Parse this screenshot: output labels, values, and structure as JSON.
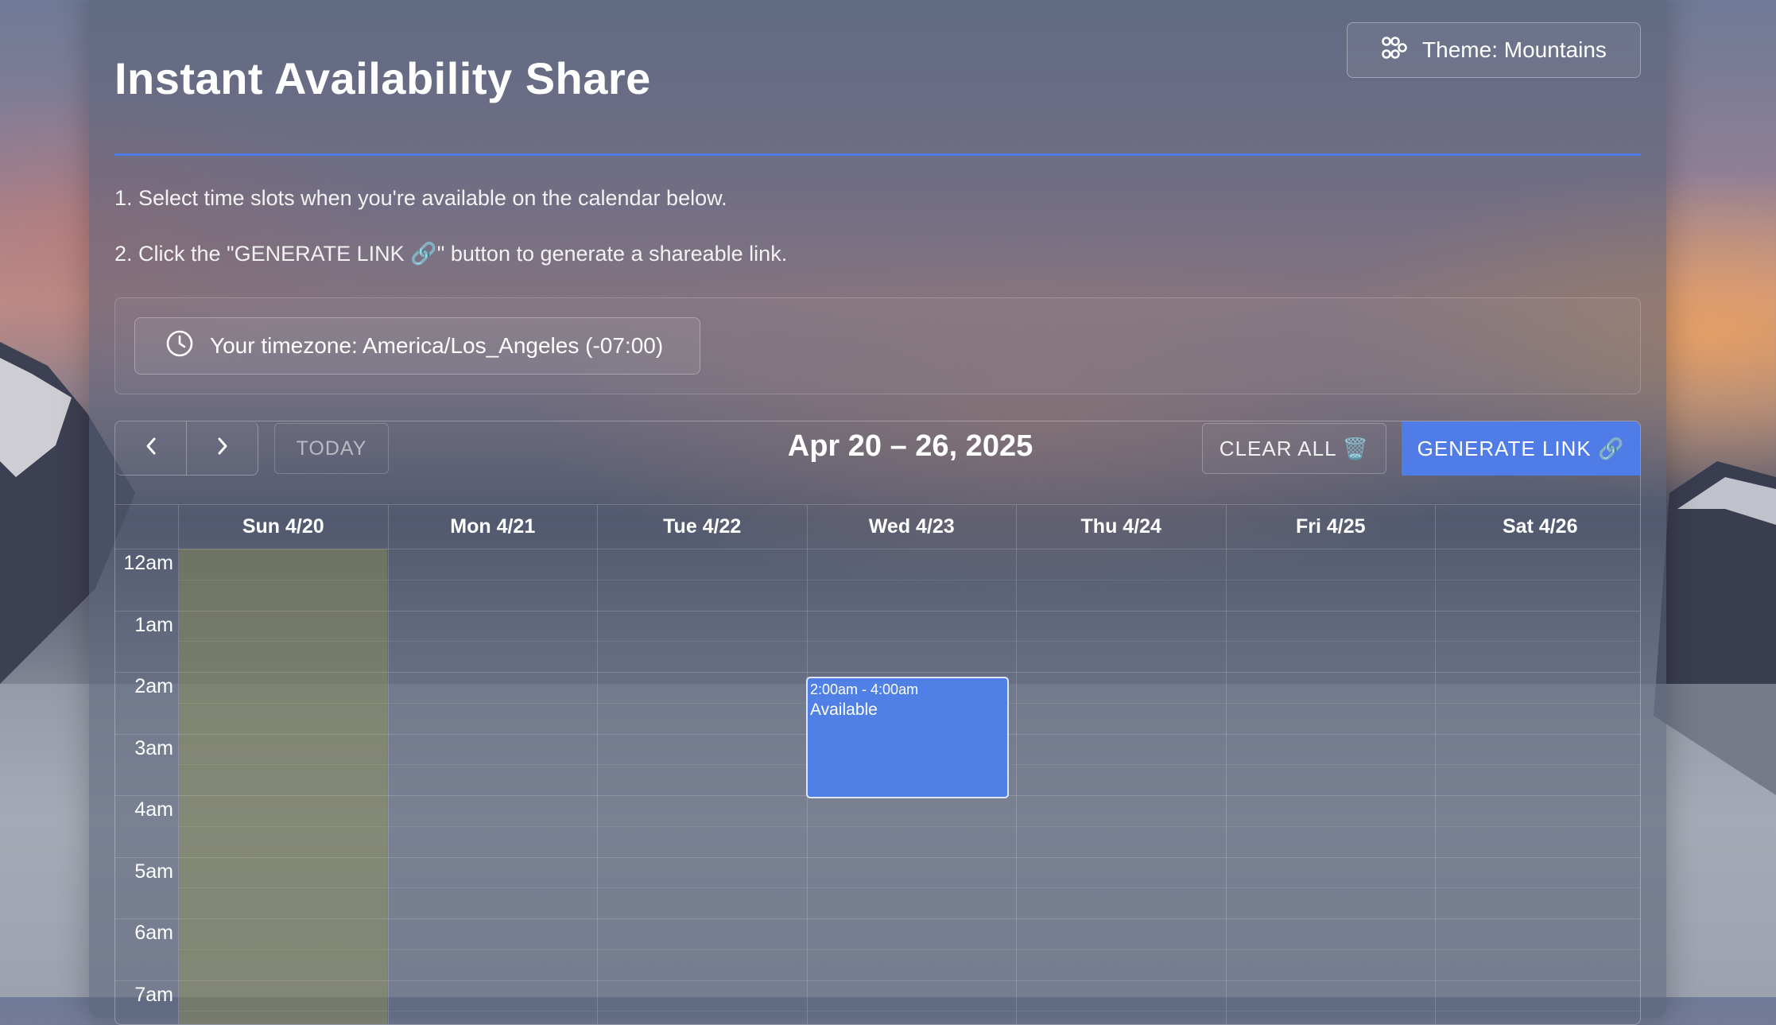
{
  "header": {
    "title": "Instant Availability Share",
    "theme_button_label": "Theme: Mountains"
  },
  "instructions": {
    "step1": "1. Select time slots when you're available on the calendar below.",
    "step2": "2. Click the \"GENERATE LINK 🔗\" button to generate a shareable link."
  },
  "timezone": {
    "label": "Your timezone: America/Los_Angeles (-07:00)"
  },
  "calendar": {
    "prev_icon": "chevron-left-icon",
    "next_icon": "chevron-right-icon",
    "today_label": "TODAY",
    "week_title": "Apr 20 – 26, 2025",
    "clear_all_label": "CLEAR ALL 🗑️",
    "generate_link_label": "GENERATE LINK 🔗",
    "days": [
      "Sun 4/20",
      "Mon 4/21",
      "Tue 4/22",
      "Wed 4/23",
      "Thu 4/24",
      "Fri 4/25",
      "Sat 4/26"
    ],
    "hours": [
      "12am",
      "1am",
      "2am",
      "3am",
      "4am",
      "5am",
      "6am",
      "7am"
    ],
    "today_index": 0,
    "events": [
      {
        "day": "Wed 4/23",
        "time": "2:00am - 4:00am",
        "title": "Available"
      }
    ]
  },
  "colors": {
    "accent": "#4f7ce6",
    "event": "#5080e6",
    "today_highlight": "#96964a"
  }
}
